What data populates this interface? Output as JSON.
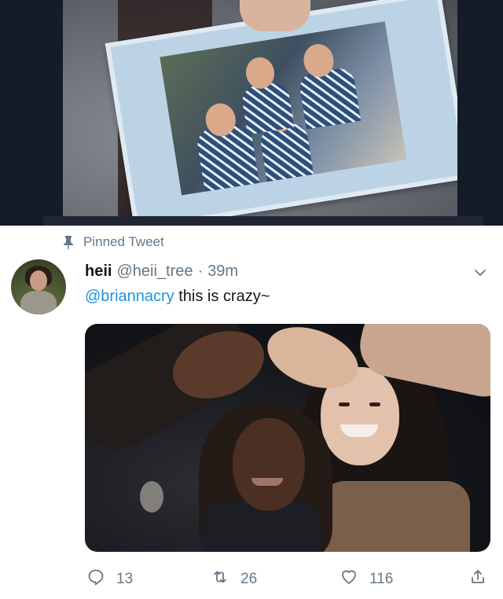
{
  "tweet": {
    "pinned_label": "Pinned Tweet",
    "display_name": "heii",
    "handle": "@heii_tree",
    "separator": "·",
    "timestamp": "39m",
    "mention": "@briannacry",
    "body": " this is crazy~"
  },
  "actions": {
    "replies": "13",
    "retweets": "26",
    "likes": "116"
  },
  "icons": {
    "pin": "pin-icon",
    "menu": "chevron-down-icon",
    "reply": "reply-icon",
    "retweet": "retweet-icon",
    "like": "heart-icon",
    "share": "share-icon"
  },
  "colors": {
    "secondary_text": "#657786",
    "link": "#1b95e0",
    "primary_text": "#14171a"
  }
}
